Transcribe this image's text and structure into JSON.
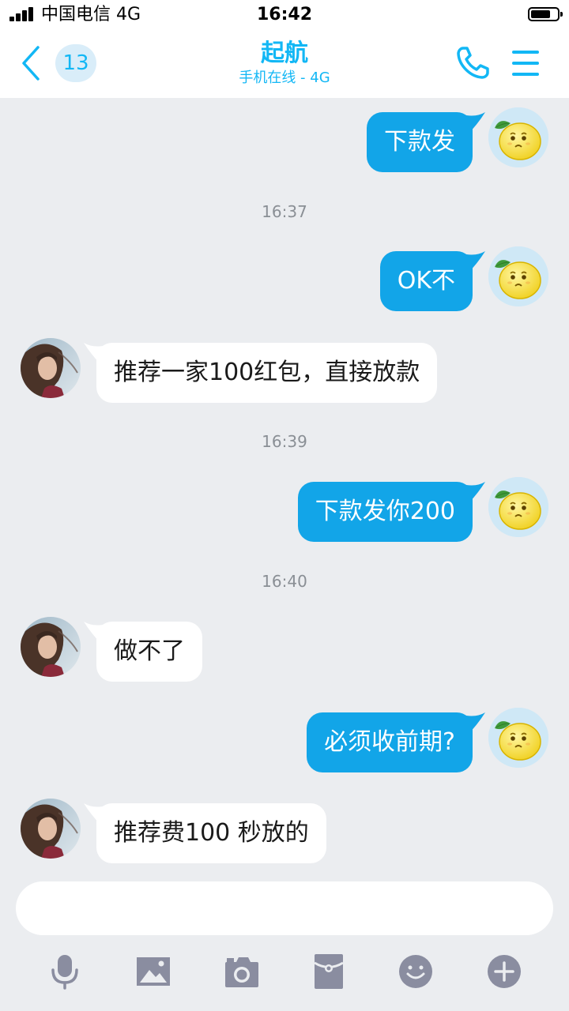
{
  "status_bar": {
    "carrier": "中国电信 4G",
    "time": "16:42",
    "battery_level": 0.75
  },
  "header": {
    "back_icon": "chevron-left-icon",
    "unread_count": "13",
    "title": "起航",
    "subtitle": "手机在线 - 4G",
    "call_icon": "phone-icon",
    "menu_icon": "hamburger-menu-icon"
  },
  "messages": [
    {
      "type": "message",
      "direction": "outgoing",
      "text": "下款发"
    },
    {
      "type": "timestamp",
      "text": "16:37"
    },
    {
      "type": "message",
      "direction": "outgoing",
      "text": "OK不"
    },
    {
      "type": "message",
      "direction": "incoming",
      "text": "推荐一家100红包，直接放款"
    },
    {
      "type": "timestamp",
      "text": "16:39"
    },
    {
      "type": "message",
      "direction": "outgoing",
      "text": "下款发你200"
    },
    {
      "type": "timestamp",
      "text": "16:40"
    },
    {
      "type": "message",
      "direction": "incoming",
      "text": "做不了"
    },
    {
      "type": "message",
      "direction": "outgoing",
      "text": "必须收前期?"
    },
    {
      "type": "message",
      "direction": "incoming",
      "text": "推荐费100  秒放的"
    }
  ],
  "input": {
    "value": "",
    "placeholder": ""
  },
  "toolbar": {
    "icons": [
      "microphone-icon",
      "image-icon",
      "camera-icon",
      "red-packet-icon",
      "emoji-icon",
      "plus-icon"
    ]
  },
  "colors": {
    "accent": "#12b7f5",
    "outgoing_bubble": "#12a5e8",
    "incoming_bubble": "#ffffff",
    "background": "#ebedf0",
    "toolbar_icon": "#8a8da0"
  }
}
